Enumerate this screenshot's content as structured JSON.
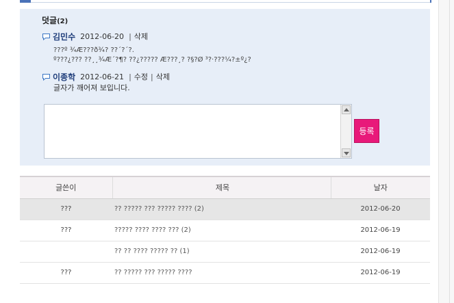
{
  "comments_section": {
    "title": "덧글",
    "count": "(2)",
    "comments": [
      {
        "author": "김민수",
        "date": "2012-06-20",
        "actions": [
          "삭제"
        ],
        "body_lines": [
          "???º ¾Æ???ð¾? ??´?´?.",
          "º???¿??? ??¸¸¾Æ´?¶? ??¿????? Æ???¸? ?§?Ø ³?·???¼?±º¿?"
        ]
      },
      {
        "author": "이종학",
        "date": "2012-06-21",
        "actions": [
          "수정",
          "삭제"
        ],
        "body_lines": [
          "글자가 깨어져 보입니다."
        ]
      }
    ],
    "reply": {
      "value": "",
      "submit_label": "등록"
    }
  },
  "board": {
    "columns": [
      "글쓴이",
      "제목",
      "날자"
    ],
    "rows": [
      {
        "writer": "???",
        "title": "?? ????? ??? ????? ???? (2)",
        "date": "2012-06-20"
      },
      {
        "writer": "???",
        "title": "????? ???? ???? ??? (2)",
        "date": "2012-06-19"
      },
      {
        "writer": "",
        "title": "?? ?? ???? ????? ?? (1)",
        "date": "2012-06-19"
      },
      {
        "writer": "???",
        "title": "?? ????? ??? ????? ????",
        "date": "2012-06-19"
      }
    ]
  },
  "colors": {
    "panel_bg": "#e7eef8",
    "submit_bg": "#e8197a",
    "author": "#1f3d7a",
    "highlight_row": "#e6e6e6"
  }
}
